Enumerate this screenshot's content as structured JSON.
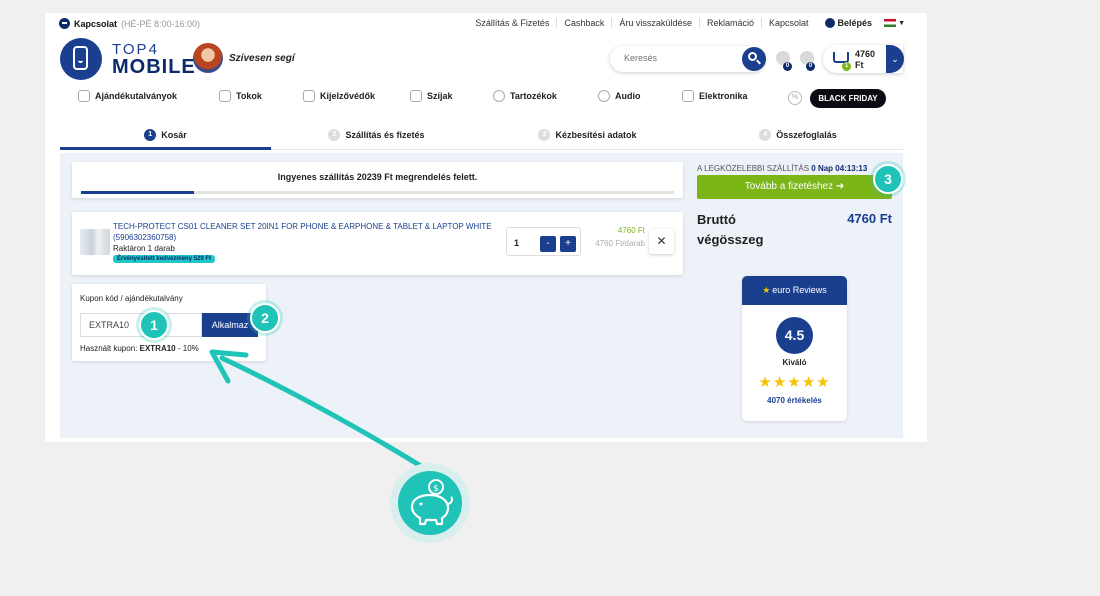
{
  "topbar": {
    "contact_label": "Kapcsolat",
    "contact_hours": "(HÉ-PÉ 8:00-16:00)",
    "links": [
      "Szállítás & Fizetés",
      "Cashback",
      "Áru visszaküldése",
      "Reklamáció",
      "Kapcsolat"
    ],
    "login_label": "Belépés"
  },
  "header": {
    "brand_top": "TOP4",
    "brand_bottom": "MOBILE",
    "greeting": "Szívesen segí",
    "search_placeholder": "Keresés",
    "wishlist_count": "0",
    "compare_count": "0",
    "cart_count": "1",
    "cart_amount": "4760 Ft"
  },
  "categories": [
    "Ajándékutalványok",
    "Tokok",
    "Kijelzővédők",
    "Szíjak",
    "Tartozékok",
    "Audio",
    "Elektronika"
  ],
  "black_friday": "BLACK FRIDAY",
  "steps": [
    {
      "num": "1",
      "label": "Kosár"
    },
    {
      "num": "2",
      "label": "Szállítás és fizetés"
    },
    {
      "num": "3",
      "label": "Kézbesítési adatok"
    },
    {
      "num": "4",
      "label": "Összefoglalás"
    }
  ],
  "shipping": {
    "text": "Ingyenes szállítás 20239 Ft megrendelés felett.",
    "progress": 0.19
  },
  "item": {
    "name": "TECH-PROTECT CS01 CLEANER SET 20IN1 FOR PHONE & EARPHONE & TABLET & LAPTOP WHITE (5906302360758)",
    "stock": "Raktáron 1 darab",
    "discount": "Érvényesített kedvezmény 529 Ft",
    "qty": "1",
    "minus": "-",
    "plus": "+",
    "price": "4760 Ft",
    "unit_price": "4760 Ft/darab",
    "remove": "✕"
  },
  "coupon": {
    "label": "Kupon kód / ajándékutalvány",
    "value": "EXTRA10",
    "apply": "Alkalmaz",
    "used_prefix": "Használt kupon:",
    "used_code": "EXTRA10",
    "used_suffix": "- 10%"
  },
  "summary": {
    "delivery_prefix": "A LEGKÖZELEBBI SZÁLLÍTÁS",
    "delivery_time": "0 Nap 04:13:13",
    "checkout": "Tovább a fizetéshez ➔",
    "total_label": "Bruttó végösszeg",
    "total_value": "4760 Ft"
  },
  "reviews": {
    "brand": "euro Reviews",
    "score": "4.5",
    "rating_word": "Kiváló",
    "stars": "★★★★★",
    "count": "4070 értékelés"
  },
  "markers": [
    "1",
    "2",
    "3"
  ],
  "colors": {
    "navy": "#1b3f8f",
    "green": "#7cb518",
    "teal": "#1fc3b7"
  }
}
